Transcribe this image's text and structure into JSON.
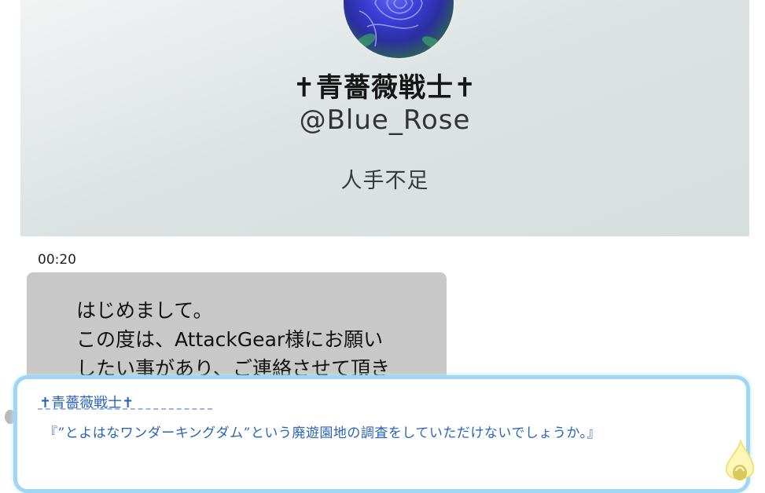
{
  "profile": {
    "display_name": "✝青薔薇戦士✝",
    "handle": "@Blue_Rose",
    "bio": "人手不足"
  },
  "chat": {
    "timestamp": "00:20",
    "message": "はじめまして。\nこの度は、AttackGear様にお願い\nしたい事があり、ご連絡させて頂き"
  },
  "dialog": {
    "speaker": "✝青薔薇戦士✝",
    "text": "『”とよはなワンダーキングダム”という廃遊園地の調査をしていただけないでしょうか。』"
  },
  "colors": {
    "dialog_border": "#9fd6f4",
    "dialog_text": "#2a64b8",
    "bubble": "#c8c8c8",
    "panel": "#dde3e3"
  },
  "icons": {
    "avatar": "blue-rose-avatar",
    "next": "advance-flame-icon"
  }
}
